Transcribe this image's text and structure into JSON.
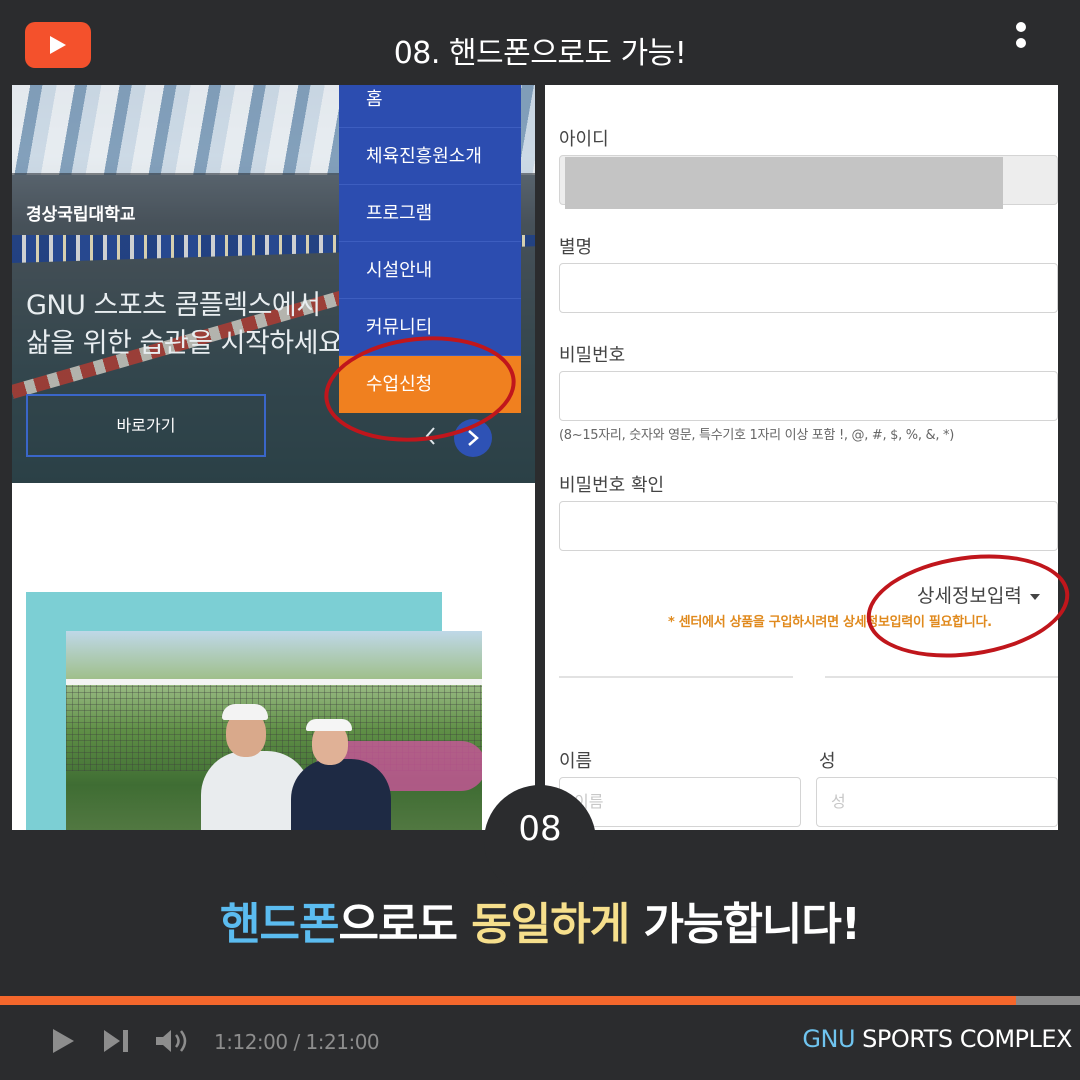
{
  "header": {
    "title": "08. 핸드폰으로도 가능!",
    "play_icon": "youtube-play-icon",
    "menu_icon": "kebab-menu-icon"
  },
  "left_screen": {
    "university": "경상국립대학교",
    "hero_line1": "GNU 스포츠 콤플렉스에서 ",
    "hero_line2": "삶을 위한 습관을 시작하세요",
    "goto_button": "바로가기",
    "menu_items": [
      {
        "label": "홈"
      },
      {
        "label": "체육진흥원소개"
      },
      {
        "label": "프로그램"
      },
      {
        "label": "시설안내"
      },
      {
        "label": "커뮤니티"
      },
      {
        "label": "수업신청"
      }
    ],
    "active_menu": "수업신청"
  },
  "right_screen": {
    "id_label": "아이디",
    "nickname_label": "별명",
    "password_label": "비밀번호",
    "password_hint": "(8~15자리, 숫자와 영문, 특수기호 1자리 이상 포함 !, @, #, $, %, &, *)",
    "password_confirm_label": "비밀번호 확인",
    "detail_toggle": "상세정보입력",
    "detail_notice": "* 센터에서 상품을 구입하시려면 상세정보입력이 필요합니다.",
    "first_name_label": "이름",
    "last_name_label": "성",
    "first_name_placeholder": "이름",
    "last_name_placeholder": "성"
  },
  "step_badge": "08",
  "caption": {
    "part1": "핸드폰",
    "part2": "으로도 ",
    "part3": "동일하게",
    "part4": " 가능합니다!"
  },
  "player": {
    "time": "1:12:00 / 1:21:00",
    "progress": 0.941,
    "brand_gnu": "GNU",
    "brand_rest": " SPORTS COMPLEX"
  },
  "colors": {
    "accent_orange": "#f4672c",
    "menu_blue": "#2c4db0",
    "active_orange": "#f0801f",
    "highlight_red": "#c0161c",
    "caption_blue": "#5bbcf0",
    "caption_yellow": "#f6df8c"
  }
}
